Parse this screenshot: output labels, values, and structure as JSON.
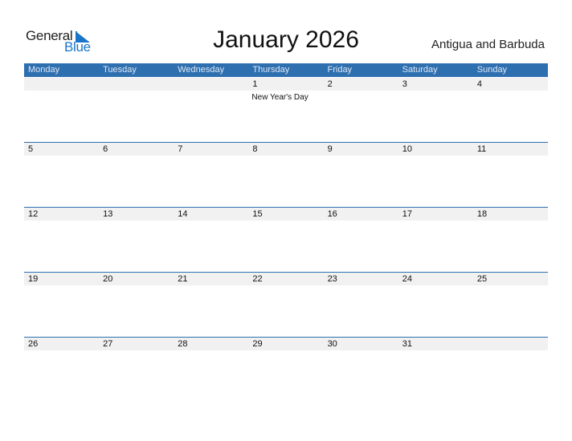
{
  "logo": {
    "part1": "General",
    "part2": "Blue"
  },
  "title": "January 2026",
  "country": "Antigua and Barbuda",
  "colors": {
    "header_bg": "#2e6fb0",
    "logo_blue": "#1a75c9",
    "daybar_bg": "#f1f1f1"
  },
  "weekdays": [
    "Monday",
    "Tuesday",
    "Wednesday",
    "Thursday",
    "Friday",
    "Saturday",
    "Sunday"
  ],
  "weeks": [
    {
      "days": [
        "",
        "",
        "",
        "1",
        "2",
        "3",
        "4"
      ],
      "holidays": [
        "",
        "",
        "",
        "New Year's Day",
        "",
        "",
        ""
      ]
    },
    {
      "days": [
        "5",
        "6",
        "7",
        "8",
        "9",
        "10",
        "11"
      ],
      "holidays": [
        "",
        "",
        "",
        "",
        "",
        "",
        ""
      ]
    },
    {
      "days": [
        "12",
        "13",
        "14",
        "15",
        "16",
        "17",
        "18"
      ],
      "holidays": [
        "",
        "",
        "",
        "",
        "",
        "",
        ""
      ]
    },
    {
      "days": [
        "19",
        "20",
        "21",
        "22",
        "23",
        "24",
        "25"
      ],
      "holidays": [
        "",
        "",
        "",
        "",
        "",
        "",
        ""
      ]
    },
    {
      "days": [
        "26",
        "27",
        "28",
        "29",
        "30",
        "31",
        ""
      ],
      "holidays": [
        "",
        "",
        "",
        "",
        "",
        "",
        ""
      ]
    }
  ]
}
